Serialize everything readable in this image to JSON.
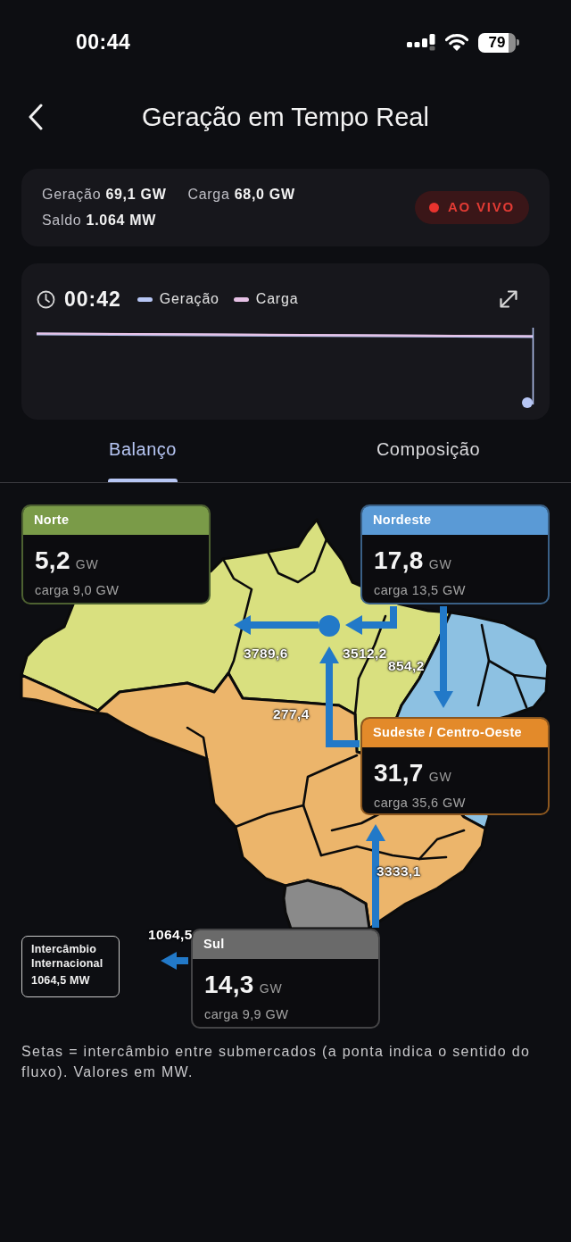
{
  "status_bar": {
    "time": "00:44",
    "battery": "79"
  },
  "header": {
    "title": "Geração em Tempo Real"
  },
  "summary": {
    "items": [
      "Geração **69,1 GW**",
      "Carga **68,0 GW**",
      "Saldo **1.064 MW**"
    ],
    "live_badge": "AO VIVO"
  },
  "chart": {
    "time": "00:42",
    "series": [
      {
        "name": "Geração",
        "color": "#b7c6f4"
      },
      {
        "name": "Carga",
        "color": "#e6c1e5"
      }
    ]
  },
  "tabs": [
    {
      "label": "Balanço",
      "selected": true
    },
    {
      "label": "Composição",
      "selected": false
    }
  ],
  "map": {
    "areas": [
      {
        "color": "#d9e07f"
      },
      {
        "color": "#8dc1e2"
      },
      {
        "color": "#ecb56b"
      },
      {
        "color": "#8a8a8a"
      }
    ],
    "regions": [
      {
        "name": "Norte",
        "value": "5,2",
        "unit": "GW",
        "load": "carga 9,0 GW",
        "color": "#7a9b48"
      },
      {
        "name": "Nordeste",
        "value": "17,8",
        "unit": "GW",
        "load": "carga 13,5 GW",
        "color": "#5a9ad6"
      },
      {
        "name": "Sudeste / Centro-Oeste",
        "value": "31,7",
        "unit": "GW",
        "load": "carga 35,6 GW",
        "color": "#e38a2a"
      },
      {
        "name": "Sul",
        "value": "14,3",
        "unit": "GW",
        "load": "carga 9,9 GW",
        "color": "#6a6a6a"
      }
    ],
    "flows": [
      {
        "label": "3789,6"
      },
      {
        "label": "3512,2"
      },
      {
        "label": "854,2"
      },
      {
        "label": "277,4"
      },
      {
        "label": "3333,1"
      },
      {
        "label": "1064,5"
      }
    ],
    "international": {
      "title": "Intercâmbio Internacional",
      "value": "1064,5 MW"
    }
  },
  "note": "Setas = intercâmbio entre submercados (a ponta indica o sentido do fluxo). Valores em MW."
}
